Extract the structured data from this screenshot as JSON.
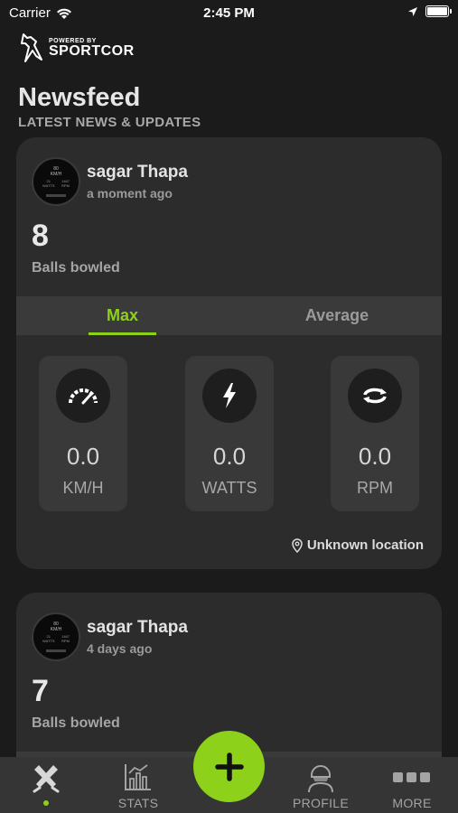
{
  "status_bar": {
    "carrier": "Carrier",
    "time": "2:45 PM"
  },
  "brand": {
    "powered_by": "POWERED BY",
    "name": "SPORTCOR"
  },
  "header": {
    "title": "Newsfeed",
    "subtitle": "LATEST NEWS & UPDATES"
  },
  "posts": [
    {
      "user": "sagar Thapa",
      "time": "a moment ago",
      "balls_count": "8",
      "balls_label": "Balls bowled",
      "tabs": [
        "Max",
        "Average"
      ],
      "metrics": [
        {
          "value": "0.0",
          "unit": "KM/H",
          "icon": "speedometer-icon"
        },
        {
          "value": "0.0",
          "unit": "WATTS",
          "icon": "lightning-icon"
        },
        {
          "value": "0.0",
          "unit": "RPM",
          "icon": "rotation-icon"
        }
      ],
      "location": "Unknown location"
    },
    {
      "user": "sagar Thapa",
      "time": "4 days ago",
      "balls_count": "7",
      "balls_label": "Balls bowled"
    }
  ],
  "bottom_nav": {
    "home_label": "",
    "stats_label": "STATS",
    "profile_label": "PROFILE",
    "more_label": "MORE"
  },
  "colors": {
    "accent": "#8ed11a",
    "background": "#1b1b1b",
    "card": "#2c2c2c"
  }
}
